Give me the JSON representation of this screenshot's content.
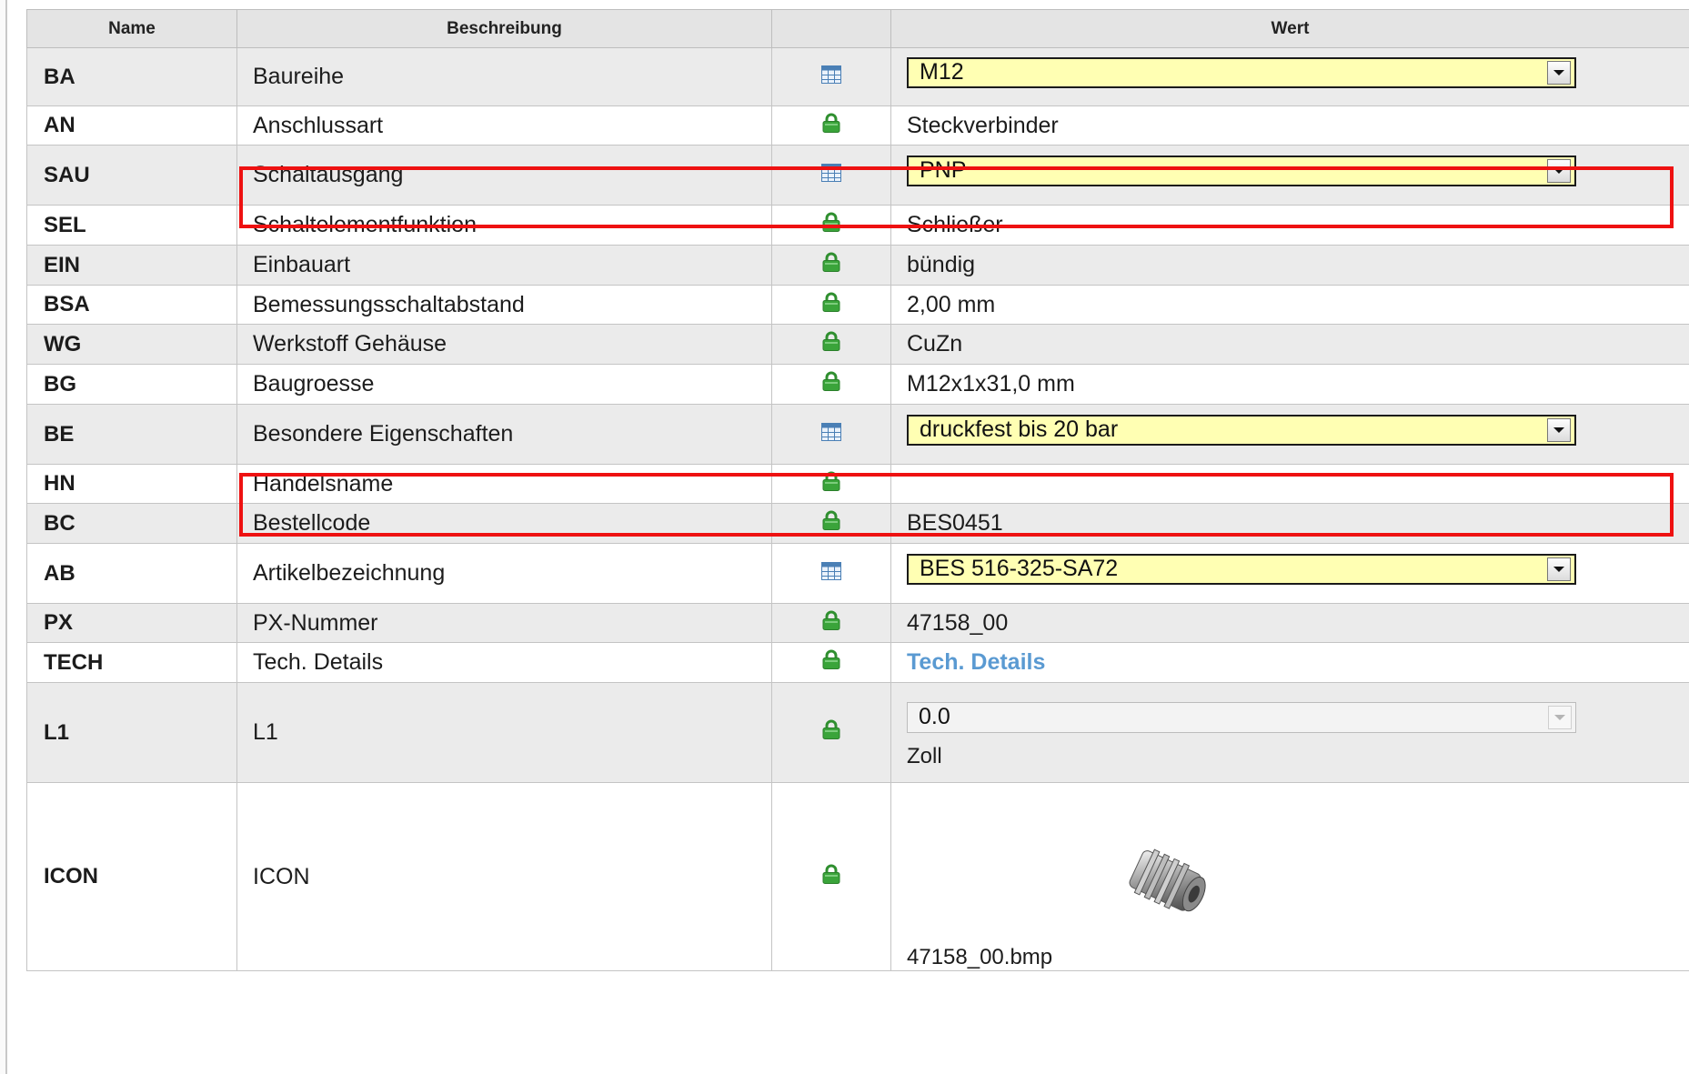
{
  "headers": {
    "name": "Name",
    "description": "Beschreibung",
    "icon": "",
    "value": "Wert"
  },
  "rows": [
    {
      "code": "BA",
      "desc": "Baureihe",
      "icon": "table-icon",
      "value": "M12",
      "type": "select"
    },
    {
      "code": "AN",
      "desc": "Anschlussart",
      "icon": "lock-icon",
      "value": "Steckverbinder",
      "type": "text"
    },
    {
      "code": "SAU",
      "desc": "Schaltausgang",
      "icon": "table-icon",
      "value": "PNP",
      "type": "select"
    },
    {
      "code": "SEL",
      "desc": "Schaltelementfunktion",
      "icon": "lock-icon",
      "value": "Schließer",
      "type": "text"
    },
    {
      "code": "EIN",
      "desc": "Einbauart",
      "icon": "lock-icon",
      "value": "bündig",
      "type": "text"
    },
    {
      "code": "BSA",
      "desc": "Bemessungsschaltabstand",
      "icon": "lock-icon",
      "value": "2,00 mm",
      "type": "text"
    },
    {
      "code": "WG",
      "desc": "Werkstoff Gehäuse",
      "icon": "lock-icon",
      "value": "CuZn",
      "type": "text"
    },
    {
      "code": "BG",
      "desc": "Baugroesse",
      "icon": "lock-icon",
      "value": "M12x1x31,0 mm",
      "type": "text"
    },
    {
      "code": "BE",
      "desc": "Besondere Eigenschaften",
      "icon": "table-icon",
      "value": "druckfest bis 20 bar",
      "type": "select"
    },
    {
      "code": "HN",
      "desc": "Handelsname",
      "icon": "lock-icon",
      "value": "",
      "type": "text"
    },
    {
      "code": "BC",
      "desc": "Bestellcode",
      "icon": "lock-icon",
      "value": "BES0451",
      "type": "text"
    },
    {
      "code": "AB",
      "desc": "Artikelbezeichnung",
      "icon": "table-icon",
      "value": "BES 516-325-SA72",
      "type": "select"
    },
    {
      "code": "PX",
      "desc": "PX-Nummer",
      "icon": "lock-icon",
      "value": "47158_00",
      "type": "text"
    },
    {
      "code": "TECH",
      "desc": "Tech. Details",
      "icon": "lock-icon",
      "value": "Tech. Details",
      "type": "link"
    },
    {
      "code": "L1",
      "desc": "L1",
      "icon": "lock-icon",
      "value": "0.0",
      "unit": "Zoll",
      "type": "select-disabled"
    },
    {
      "code": "ICON",
      "desc": "ICON",
      "icon": "lock-icon",
      "value": "47158_00.bmp",
      "type": "image"
    }
  ],
  "highlights": [
    "SAU",
    "BE"
  ],
  "colors": {
    "highlight": "#ee1111",
    "select_bg": "#ffffb3",
    "link": "#5a9ad2",
    "lock": "#3aa43a",
    "grid_icon": "#4a7fb5"
  }
}
